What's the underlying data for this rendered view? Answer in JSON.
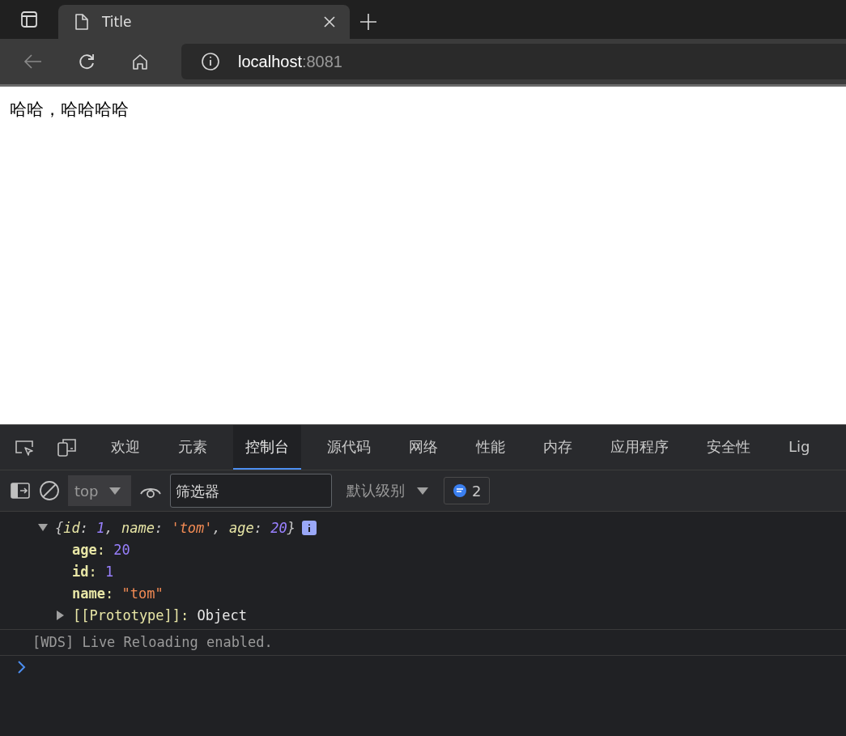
{
  "browser": {
    "tab": {
      "title": "Title",
      "selected": true
    },
    "address": {
      "host": "localhost",
      "port": ":8081"
    }
  },
  "page": {
    "text": "哈哈，哈哈哈哈"
  },
  "devtools": {
    "tabs": [
      {
        "label": "欢迎",
        "selected": false
      },
      {
        "label": "元素",
        "selected": false
      },
      {
        "label": "控制台",
        "selected": true
      },
      {
        "label": "源代码",
        "selected": false
      },
      {
        "label": "网络",
        "selected": false
      },
      {
        "label": "性能",
        "selected": false
      },
      {
        "label": "内存",
        "selected": false
      },
      {
        "label": "应用程序",
        "selected": false
      },
      {
        "label": "安全性",
        "selected": false
      },
      {
        "label": "Lig",
        "selected": false
      }
    ],
    "toolbar": {
      "context": "top",
      "filter_placeholder": "筛选器",
      "level": "默认级别",
      "message_count": "2"
    },
    "console": {
      "entries": [
        {
          "kind": "object",
          "expanded": true,
          "preview": [
            {
              "kind": "punct",
              "text": "{"
            },
            {
              "kind": "key",
              "text": "id"
            },
            {
              "kind": "punct",
              "text": ": "
            },
            {
              "kind": "number",
              "text": "1"
            },
            {
              "kind": "punct",
              "text": ", "
            },
            {
              "kind": "key",
              "text": "name"
            },
            {
              "kind": "punct",
              "text": ": "
            },
            {
              "kind": "string",
              "text": "'tom'"
            },
            {
              "kind": "punct",
              "text": ", "
            },
            {
              "kind": "key",
              "text": "age"
            },
            {
              "kind": "punct",
              "text": ": "
            },
            {
              "kind": "number",
              "text": "20"
            },
            {
              "kind": "punct",
              "text": "}"
            }
          ],
          "properties": [
            [
              {
                "kind": "key",
                "text": "age"
              },
              {
                "kind": "colon",
                "text": ": "
              },
              {
                "kind": "number",
                "text": "20"
              }
            ],
            [
              {
                "kind": "key",
                "text": "id"
              },
              {
                "kind": "colon",
                "text": ": "
              },
              {
                "kind": "number",
                "text": "1"
              }
            ],
            [
              {
                "kind": "key",
                "text": "name"
              },
              {
                "kind": "colon",
                "text": ": "
              },
              {
                "kind": "string",
                "text": "\"tom\""
              }
            ]
          ],
          "prototype": {
            "expanded": false,
            "segments": [
              {
                "kind": "colon",
                "text": "[[Prototype]]: "
              },
              {
                "kind": "plain",
                "text": "Object"
              }
            ]
          }
        },
        {
          "kind": "log",
          "text": "[WDS] Live Reloading enabled."
        }
      ]
    }
  }
}
